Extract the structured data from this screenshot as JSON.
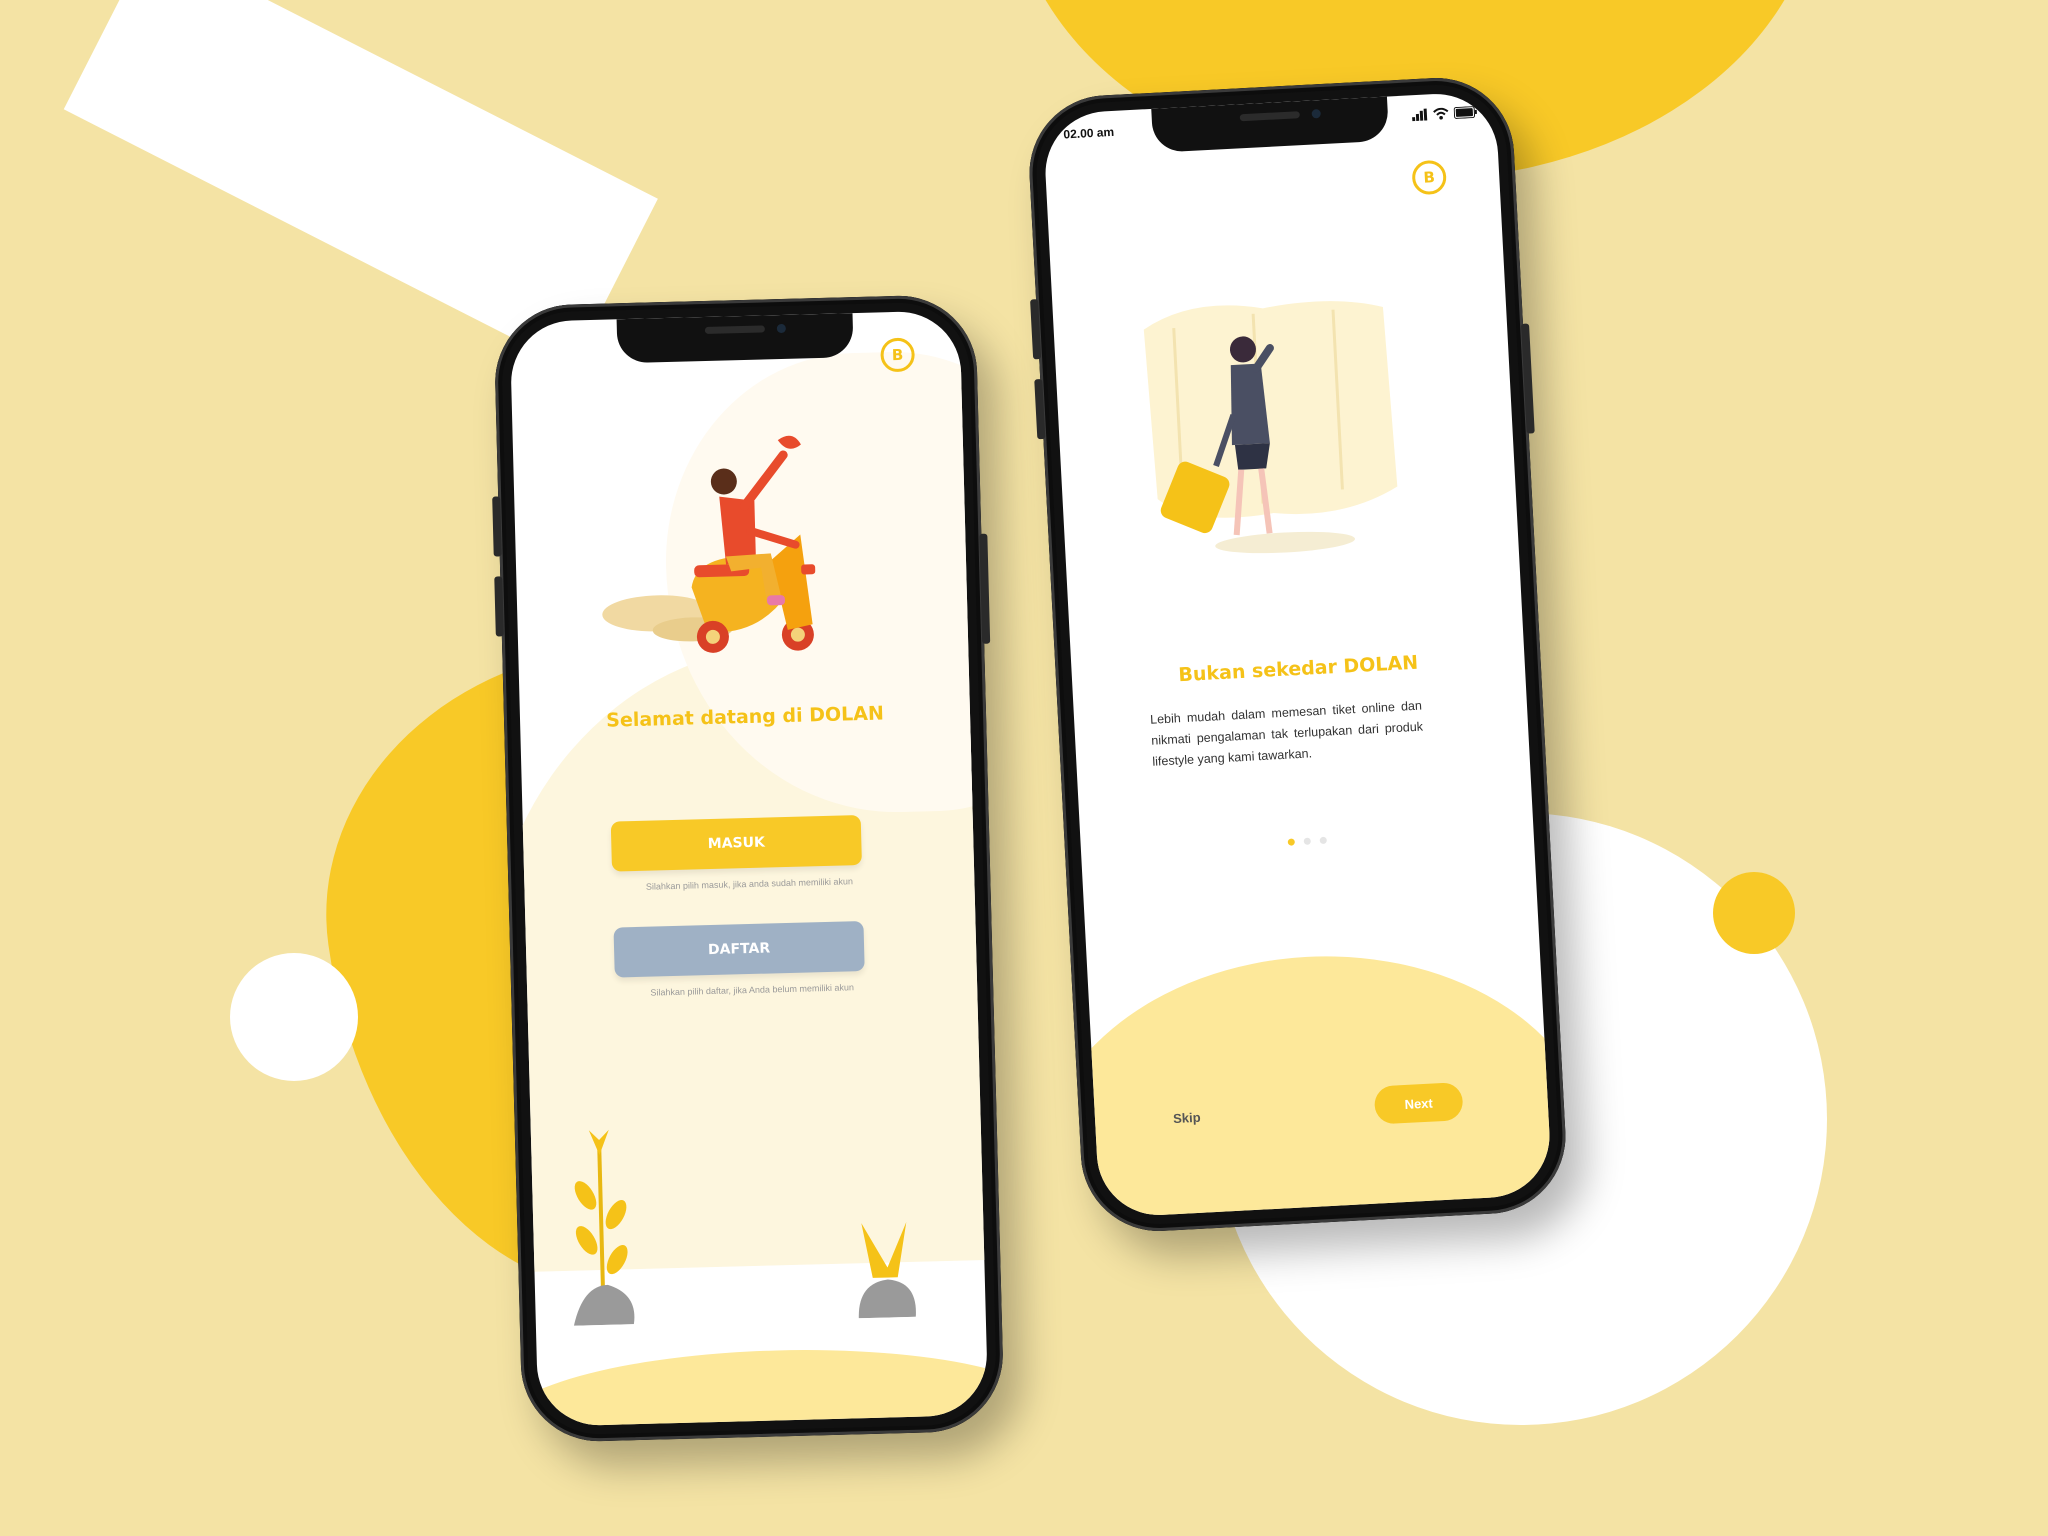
{
  "colors": {
    "background": "#f4e3a4",
    "accent": "#f8c927",
    "secondary_button": "#9fb1c5",
    "white": "#ffffff"
  },
  "logo": {
    "glyph": "B",
    "icon": "dolan-logo-icon"
  },
  "welcome_screen": {
    "title": "Selamat datang di DOLAN",
    "masuk_button": "MASUK",
    "masuk_hint": "Silahkan pilih masuk, jika anda sudah memiliki akun",
    "daftar_button": "DAFTAR",
    "daftar_hint": "Silahkan pilih daftar, jika Anda belum memiliki akun"
  },
  "onboarding_screen": {
    "status_time": "02.00 am",
    "title": "Bukan sekedar DOLAN",
    "description": "Lebih mudah dalam memesan tiket online dan nikmati pengalaman tak terlupakan dari produk lifestyle yang kami tawarkan.",
    "page_indicator": {
      "total": 3,
      "active": 1
    },
    "skip_label": "Skip",
    "next_label": "Next"
  }
}
